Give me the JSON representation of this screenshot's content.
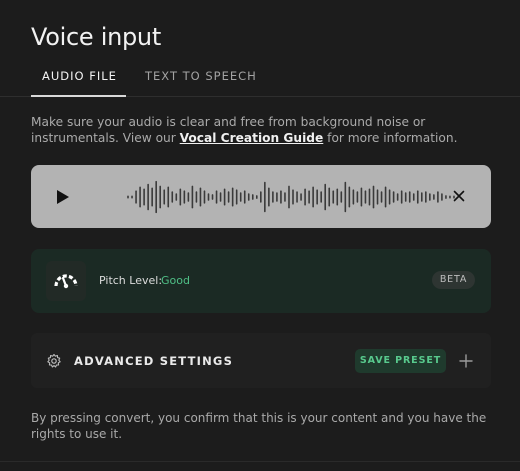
{
  "header": {
    "title": "Voice input"
  },
  "tabs": [
    {
      "label": "AUDIO FILE",
      "active": true
    },
    {
      "label": "TEXT TO SPEECH",
      "active": false
    }
  ],
  "intro": {
    "prefix": "Make sure your audio is clear and free from background noise or instrumentals. View our ",
    "link_text": "Vocal Creation Guide",
    "suffix": " for more information."
  },
  "player": {
    "play_icon": "play-icon",
    "close_icon": "close-icon",
    "waveform_levels": [
      0.08,
      0.08,
      0.35,
      0.55,
      0.45,
      0.7,
      0.5,
      0.85,
      0.6,
      0.4,
      0.55,
      0.3,
      0.2,
      0.45,
      0.35,
      0.25,
      0.6,
      0.3,
      0.5,
      0.35,
      0.2,
      0.15,
      0.35,
      0.25,
      0.45,
      0.3,
      0.5,
      0.4,
      0.25,
      0.35,
      0.2,
      0.15,
      0.1,
      0.3,
      0.8,
      0.5,
      0.3,
      0.25,
      0.35,
      0.25,
      0.6,
      0.4,
      0.3,
      0.2,
      0.45,
      0.35,
      0.55,
      0.4,
      0.3,
      0.7,
      0.5,
      0.35,
      0.45,
      0.3,
      0.8,
      0.55,
      0.4,
      0.3,
      0.5,
      0.35,
      0.45,
      0.6,
      0.4,
      0.3,
      0.55,
      0.4,
      0.3,
      0.2,
      0.35,
      0.25,
      0.3,
      0.2,
      0.35,
      0.25,
      0.3,
      0.2,
      0.15,
      0.3,
      0.2,
      0.1,
      0.08,
      0.08
    ]
  },
  "pitch": {
    "icon": "gauge-icon",
    "label": "Pitch Level:",
    "value": "Good",
    "badge": "BETA",
    "value_color": "#4fbf86"
  },
  "advanced": {
    "icon": "gear-icon",
    "label": "ADVANCED SETTINGS",
    "save_preset_label": "SAVE PRESET",
    "add_icon": "plus-icon"
  },
  "disclaimer": "By pressing convert, you confirm that this is your content and you have the rights to use it."
}
